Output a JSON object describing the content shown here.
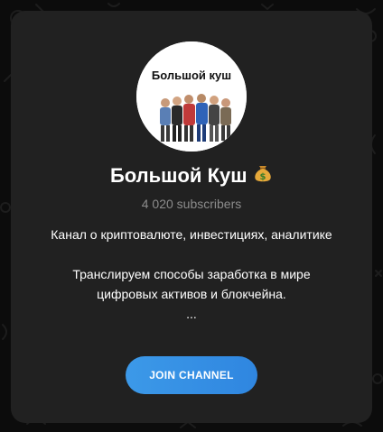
{
  "channel": {
    "name": "Большой Куш",
    "name_emoji": "moneybag-emoji",
    "subscribers": "4 020 subscribers",
    "avatar_caption": "Большой куш",
    "description": [
      "Канал о криптовалюте, инвестициях, аналитике",
      "",
      "Транслируем способы заработка в мире",
      "цифровых активов и блокчейна.",
      "..."
    ]
  },
  "actions": {
    "join_label": "JOIN CHANNEL"
  },
  "colors": {
    "page_background": "#0c0c0c",
    "card_background": "#212121",
    "subtitle": "#8c8c8c",
    "accent": "#3390ec",
    "text": "#ffffff"
  }
}
